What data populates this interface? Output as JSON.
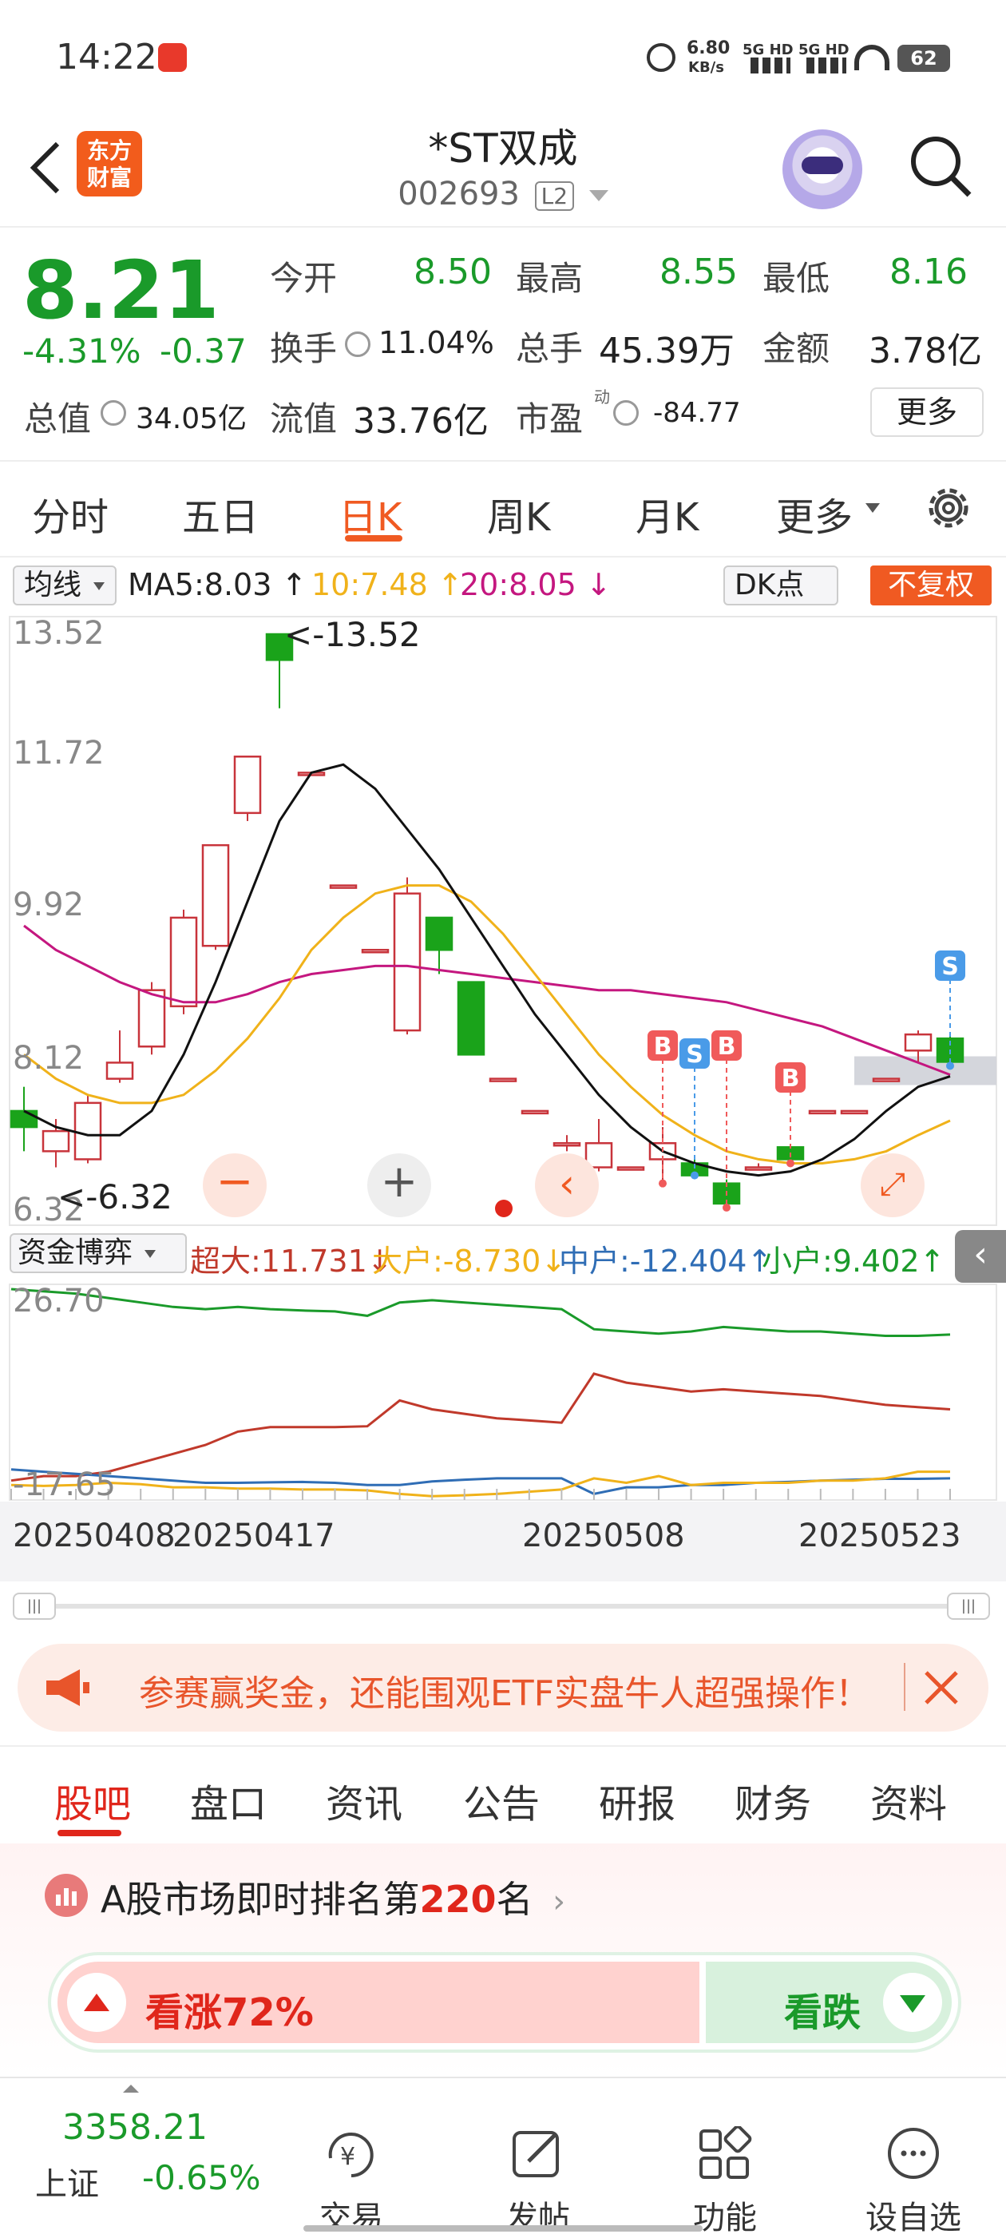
{
  "status": {
    "time": "14:22",
    "net_speed_value": "6.80",
    "net_speed_unit": "KB/s",
    "signal1": "5G HD",
    "signal2": "5G HD",
    "battery": "62"
  },
  "header": {
    "back": "back",
    "logo_line1": "东方",
    "logo_line2": "财富",
    "stock_name": "*ST双成",
    "stock_code": "002693",
    "level": "L2"
  },
  "quote": {
    "price": "8.21",
    "change_pct": "-4.31%",
    "change": "-0.37",
    "open_label": "今开",
    "open": "8.50",
    "high_label": "最高",
    "high": "8.55",
    "low_label": "最低",
    "low": "8.16",
    "turnover_label": "换手",
    "turnover": "11.04%",
    "volume_label": "总手",
    "volume": "45.39万",
    "amount_label": "金额",
    "amount": "3.78亿",
    "mcap_label": "总值",
    "mcap": "34.05亿",
    "float_label": "流值",
    "float_cap": "33.76亿",
    "pe_label": "市盈",
    "pe_sup": "动",
    "pe": "-84.77",
    "more": "更多"
  },
  "tabs": [
    "分时",
    "五日",
    "日K",
    "周K",
    "月K",
    "更多"
  ],
  "active_tab": "日K",
  "indicator": {
    "ma_select": "均线",
    "ma5": "MA5:8.03",
    "ma10": "10:7.48",
    "ma20": "20:8.05",
    "dk": "DK点",
    "fq": "不复权"
  },
  "chart": {
    "y_labels": [
      "13.52",
      "11.72",
      "9.92",
      "8.12",
      "6.32"
    ],
    "max_marker": "<-13.52",
    "min_marker": "<-6.32",
    "buy_label": "B",
    "sell_label": "S",
    "colors": {
      "up": "#c8343b",
      "down": "#1aa31a",
      "ma5": "#111111",
      "ma10": "#f0b21a",
      "ma20": "#c4177f"
    },
    "candles": [
      {
        "o": 7.6,
        "c": 7.4,
        "h": 7.9,
        "l": 7.1
      },
      {
        "o": 7.1,
        "c": 7.35,
        "h": 7.5,
        "l": 6.9
      },
      {
        "o": 7.0,
        "c": 7.7,
        "h": 7.8,
        "l": 6.95
      },
      {
        "o": 8.0,
        "c": 8.2,
        "h": 8.6,
        "l": 7.95
      },
      {
        "o": 8.4,
        "c": 9.1,
        "h": 9.2,
        "l": 8.3
      },
      {
        "o": 8.9,
        "c": 10.0,
        "h": 10.1,
        "l": 8.8
      },
      {
        "o": 9.65,
        "c": 10.9,
        "h": 10.9,
        "l": 9.6
      },
      {
        "o": 11.3,
        "c": 12.0,
        "h": 12.0,
        "l": 11.2
      },
      {
        "o": 13.52,
        "c": 13.2,
        "h": 13.52,
        "l": 12.6
      },
      {
        "o": 11.8,
        "c": 11.8,
        "h": 11.8,
        "l": 11.8
      },
      {
        "o": 10.4,
        "c": 10.4,
        "h": 10.4,
        "l": 10.4
      },
      {
        "o": 9.6,
        "c": 9.6,
        "h": 9.6,
        "l": 9.6
      },
      {
        "o": 8.6,
        "c": 10.3,
        "h": 10.5,
        "l": 8.55
      },
      {
        "o": 10.0,
        "c": 9.6,
        "h": 10.0,
        "l": 9.3
      },
      {
        "o": 9.2,
        "c": 8.3,
        "h": 9.2,
        "l": 8.3
      },
      {
        "o": 8.0,
        "c": 8.0,
        "h": 8.0,
        "l": 8.0
      },
      {
        "o": 7.6,
        "c": 7.6,
        "h": 7.6,
        "l": 7.6
      },
      {
        "o": 7.2,
        "c": 7.2,
        "h": 7.3,
        "l": 7.1
      },
      {
        "o": 6.9,
        "c": 7.2,
        "h": 7.5,
        "l": 6.85
      },
      {
        "o": 6.9,
        "c": 6.9,
        "h": 6.9,
        "l": 6.9
      },
      {
        "o": 7.0,
        "c": 7.2,
        "h": 7.4,
        "l": 6.7
      },
      {
        "o": 6.95,
        "c": 6.8,
        "h": 7.0,
        "l": 6.8
      },
      {
        "o": 6.7,
        "c": 6.45,
        "h": 6.75,
        "l": 6.4
      },
      {
        "o": 6.9,
        "c": 6.9,
        "h": 6.95,
        "l": 6.9
      },
      {
        "o": 7.15,
        "c": 7.0,
        "h": 7.15,
        "l": 6.95
      },
      {
        "o": 7.6,
        "c": 7.6,
        "h": 7.6,
        "l": 7.6
      },
      {
        "o": 7.6,
        "c": 7.6,
        "h": 7.6,
        "l": 7.6
      },
      {
        "o": 8.0,
        "c": 8.0,
        "h": 8.0,
        "l": 8.0
      },
      {
        "o": 8.35,
        "c": 8.55,
        "h": 8.6,
        "l": 8.2
      },
      {
        "o": 8.5,
        "c": 8.21,
        "h": 8.55,
        "l": 8.16
      }
    ],
    "ma5": [
      7.6,
      7.4,
      7.3,
      7.3,
      7.6,
      8.3,
      9.2,
      10.2,
      11.2,
      11.8,
      11.9,
      11.6,
      11.1,
      10.6,
      10.0,
      9.4,
      8.8,
      8.3,
      7.8,
      7.4,
      7.1,
      6.95,
      6.85,
      6.8,
      6.85,
      7.0,
      7.25,
      7.6,
      7.9,
      8.03
    ],
    "ma10": [
      8.3,
      8.0,
      7.8,
      7.7,
      7.7,
      7.8,
      8.1,
      8.5,
      9.0,
      9.6,
      10.0,
      10.3,
      10.4,
      10.4,
      10.2,
      9.8,
      9.3,
      8.8,
      8.3,
      7.9,
      7.55,
      7.3,
      7.1,
      7.0,
      6.95,
      6.95,
      7.0,
      7.1,
      7.3,
      7.48
    ],
    "ma20": [
      9.9,
      9.6,
      9.4,
      9.2,
      9.05,
      8.95,
      8.95,
      9.05,
      9.2,
      9.3,
      9.35,
      9.4,
      9.4,
      9.35,
      9.3,
      9.25,
      9.2,
      9.15,
      9.1,
      9.1,
      9.05,
      9.0,
      8.95,
      8.85,
      8.75,
      8.65,
      8.5,
      8.35,
      8.2,
      8.05
    ],
    "signals": [
      {
        "i": 20,
        "type": "B"
      },
      {
        "i": 21,
        "type": "S"
      },
      {
        "i": 22,
        "type": "B"
      },
      {
        "i": 24,
        "type": "B"
      },
      {
        "i": 29,
        "type": "S"
      }
    ],
    "support": "8.1"
  },
  "fund": {
    "select": "资金博弈",
    "super": "超大:11.731",
    "large": "大户:-8.730",
    "mid": "中户:-12.404",
    "small": "小户:9.402",
    "y_top": "26.70",
    "y_bottom": "-17.65",
    "colors": {
      "super": "#c0392b",
      "large": "#f0b21a",
      "mid": "#2f6db5",
      "small": "#1a9a2a"
    },
    "super_vals": [
      -16,
      -15,
      -15,
      -14,
      -12,
      -10,
      -8,
      -5,
      -4,
      -4,
      -4,
      -3.8,
      2,
      0,
      -1,
      -2,
      -2.5,
      -3,
      8,
      6,
      5,
      4,
      4.5,
      4,
      3.5,
      3,
      2,
      1,
      0.5,
      0
    ],
    "large_vals": [
      -17,
      -17.2,
      -17,
      -16.5,
      -16.8,
      -17.5,
      -17.5,
      -17.8,
      -17.8,
      -18,
      -18,
      -18.2,
      -19,
      -19.5,
      -19.3,
      -19,
      -18.5,
      -18,
      -15.5,
      -16.5,
      -15,
      -17,
      -16.5,
      -16.5,
      -16.5,
      -16,
      -16,
      -15.5,
      -14,
      -14
    ],
    "mid_vals": [
      -13.5,
      -14,
      -14.5,
      -15,
      -15.5,
      -16,
      -16.5,
      -16.5,
      -16.4,
      -16.3,
      -16.5,
      -17,
      -17,
      -16.2,
      -15.8,
      -15.5,
      -15.5,
      -15.5,
      -19,
      -17.5,
      -17.5,
      -17,
      -17,
      -16.5,
      -16.3,
      -16,
      -15.8,
      -15.6,
      -15.6,
      -15.5
    ],
    "small_vals": [
      27,
      26.5,
      26,
      25,
      24,
      23,
      22.5,
      23,
      22.5,
      22.2,
      22,
      21,
      24,
      24.5,
      24,
      23.5,
      23,
      22.5,
      18,
      17.5,
      17,
      17.5,
      18.5,
      18,
      17.5,
      17.5,
      17,
      16.5,
      16.5,
      16.8
    ]
  },
  "dates": [
    "20250408",
    "20250417",
    "20250508",
    "20250523"
  ],
  "banner": "参赛赢奖金，还能围观ETF实盘牛人超强操作！",
  "subtabs": [
    "股吧",
    "盘口",
    "资讯",
    "公告",
    "研报",
    "财务",
    "资料"
  ],
  "active_subtab": "股吧",
  "rank": {
    "prefix": "A股市场即时排名第",
    "rank": "220",
    "suffix": "名",
    "bull": "看涨72%",
    "bear": "看跌",
    "bull_pct": 0.72
  },
  "bottom": {
    "index_value": "3358.21",
    "index_name": "上证",
    "index_change": "-0.65%",
    "trade": "交易",
    "post": "发帖",
    "func": "功能",
    "watch": "设自选"
  }
}
